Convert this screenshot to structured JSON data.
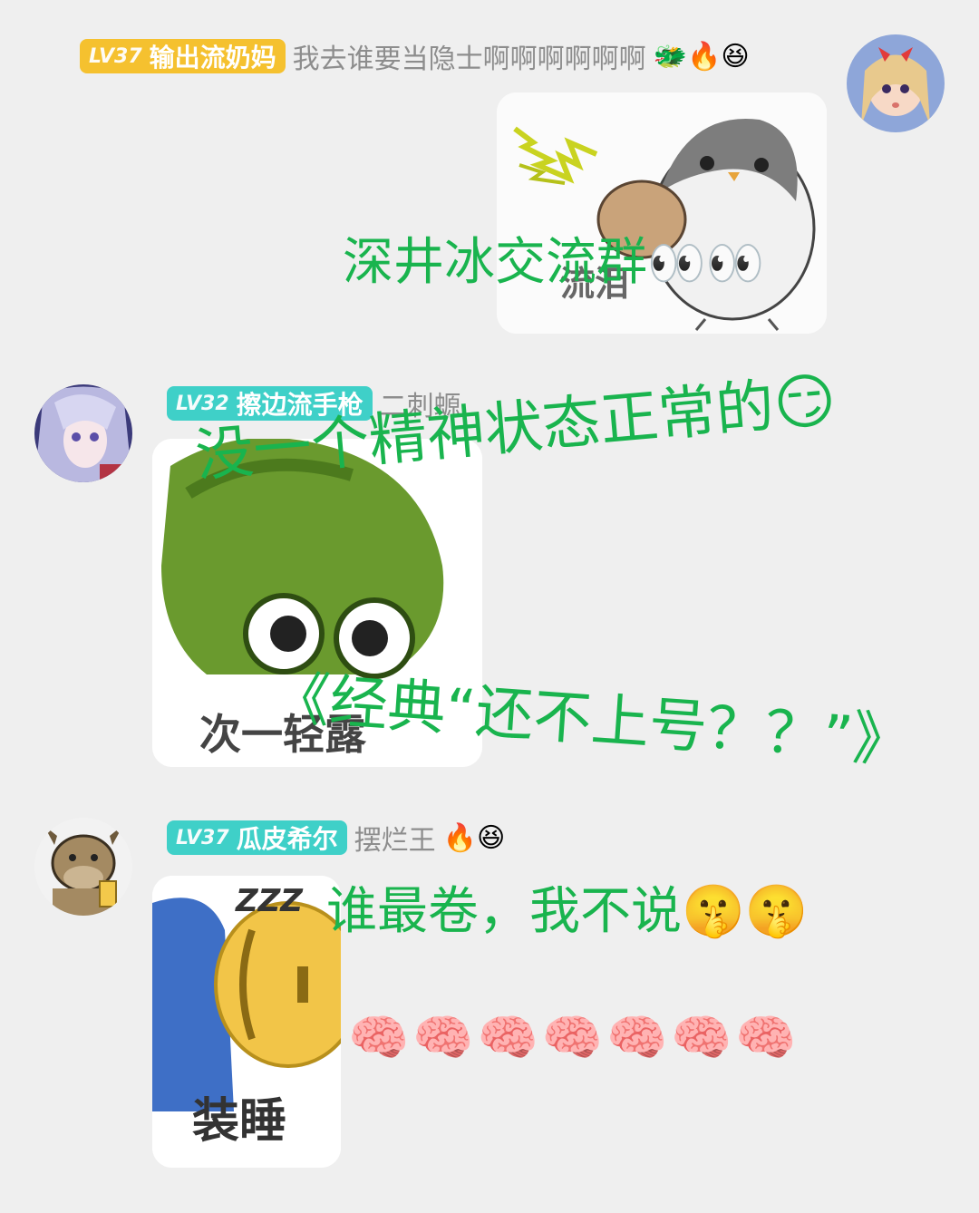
{
  "messages": [
    {
      "level": "LV37",
      "nickname": "输出流奶妈",
      "title": "我去谁要当隐士啊啊啊啊啊啊",
      "title_emojis": "🐲🔥😆",
      "badge_color": "#f5c12f",
      "sticker_caption": "流泪"
    },
    {
      "level": "LV32",
      "nickname": "擦边流手枪",
      "title": "二刺螈",
      "badge_color": "#3fd0c8",
      "sticker_caption": "次一轻露"
    },
    {
      "level": "LV37",
      "nickname": "瓜皮希尔",
      "title": "摆烂王",
      "title_emojis": "🔥😆",
      "badge_color": "#3fd0c8",
      "sticker_caption": "装睡",
      "sticker_zzz": "ZZZ"
    }
  ],
  "overlays": {
    "line1": "深井冰交流群",
    "line1_emojis": "👀👀",
    "line2": "没一个精神状态正常的",
    "line2_emoji": "😏",
    "line3": "《经典“还不上号？？”》",
    "line4": "谁最卷，我不说",
    "line4_emojis": "🤫🤫",
    "line5_emojis": "🧠🧠🧠🧠🧠🧠🧠"
  },
  "colors": {
    "overlay_text": "#19b44e",
    "bg": "#efefef"
  }
}
